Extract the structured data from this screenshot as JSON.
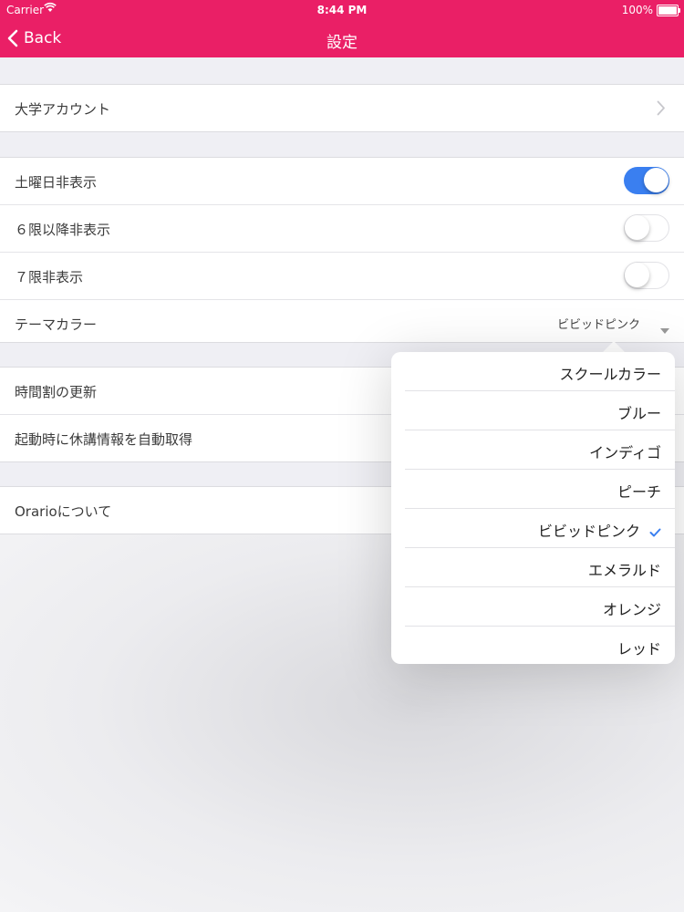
{
  "status_bar": {
    "carrier": "Carrier",
    "time": "8:44 PM",
    "battery": "100%"
  },
  "nav": {
    "back_label": "Back",
    "title": "設定"
  },
  "sections": {
    "account": {
      "label": "大学アカウント"
    },
    "display": {
      "hide_saturday": {
        "label": "土曜日非表示",
        "on": true
      },
      "hide_6th": {
        "label": "６限以降非表示",
        "on": false
      },
      "hide_7th": {
        "label": "７限非表示",
        "on": false
      },
      "theme_color": {
        "label": "テーマカラー",
        "value": "ビビッドピンク"
      }
    },
    "sync": {
      "refresh": {
        "label": "時間割の更新"
      },
      "auto_fetch": {
        "label": "起動時に休講情報を自動取得"
      }
    },
    "about": {
      "label": "Orarioについて"
    }
  },
  "theme_options": [
    {
      "label": "スクールカラー",
      "selected": false
    },
    {
      "label": "ブルー",
      "selected": false
    },
    {
      "label": "インディゴ",
      "selected": false
    },
    {
      "label": "ピーチ",
      "selected": false
    },
    {
      "label": "ビビッドピンク",
      "selected": true
    },
    {
      "label": "エメラルド",
      "selected": false
    },
    {
      "label": "オレンジ",
      "selected": false
    },
    {
      "label": "レッド",
      "selected": false
    }
  ],
  "colors": {
    "accent": "#ea1f66",
    "toggle_on": "#3a7ff0",
    "checkmark": "#3a7ff0"
  }
}
